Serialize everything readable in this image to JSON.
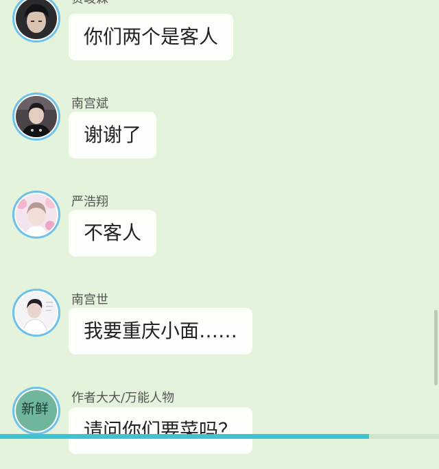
{
  "messages": [
    {
      "sender": "贺峻霖",
      "text": "你们两个是客人",
      "avatar_icon": "portrait-dark-hair"
    },
    {
      "sender": "南宫斌",
      "text": "谢谢了",
      "avatar_icon": "portrait-dark-jacket"
    },
    {
      "sender": "严浩翔",
      "text": "不客人",
      "avatar_icon": "portrait-pink-flowers"
    },
    {
      "sender": "南宫世",
      "text": "我要重庆小面……",
      "avatar_icon": "portrait-light-background"
    },
    {
      "sender": "作者大大/万能人物",
      "text": "请问你们要菜吗？",
      "avatar_icon": "portrait-handwritten-badge",
      "avatar_text": "新鲜"
    }
  ],
  "colors": {
    "background": "#e4f4dc",
    "bubble": "#fcfffa",
    "avatar_ring": "#6cc0ea",
    "progress": "#3fc3d3"
  },
  "bottom_progress": 0.84
}
